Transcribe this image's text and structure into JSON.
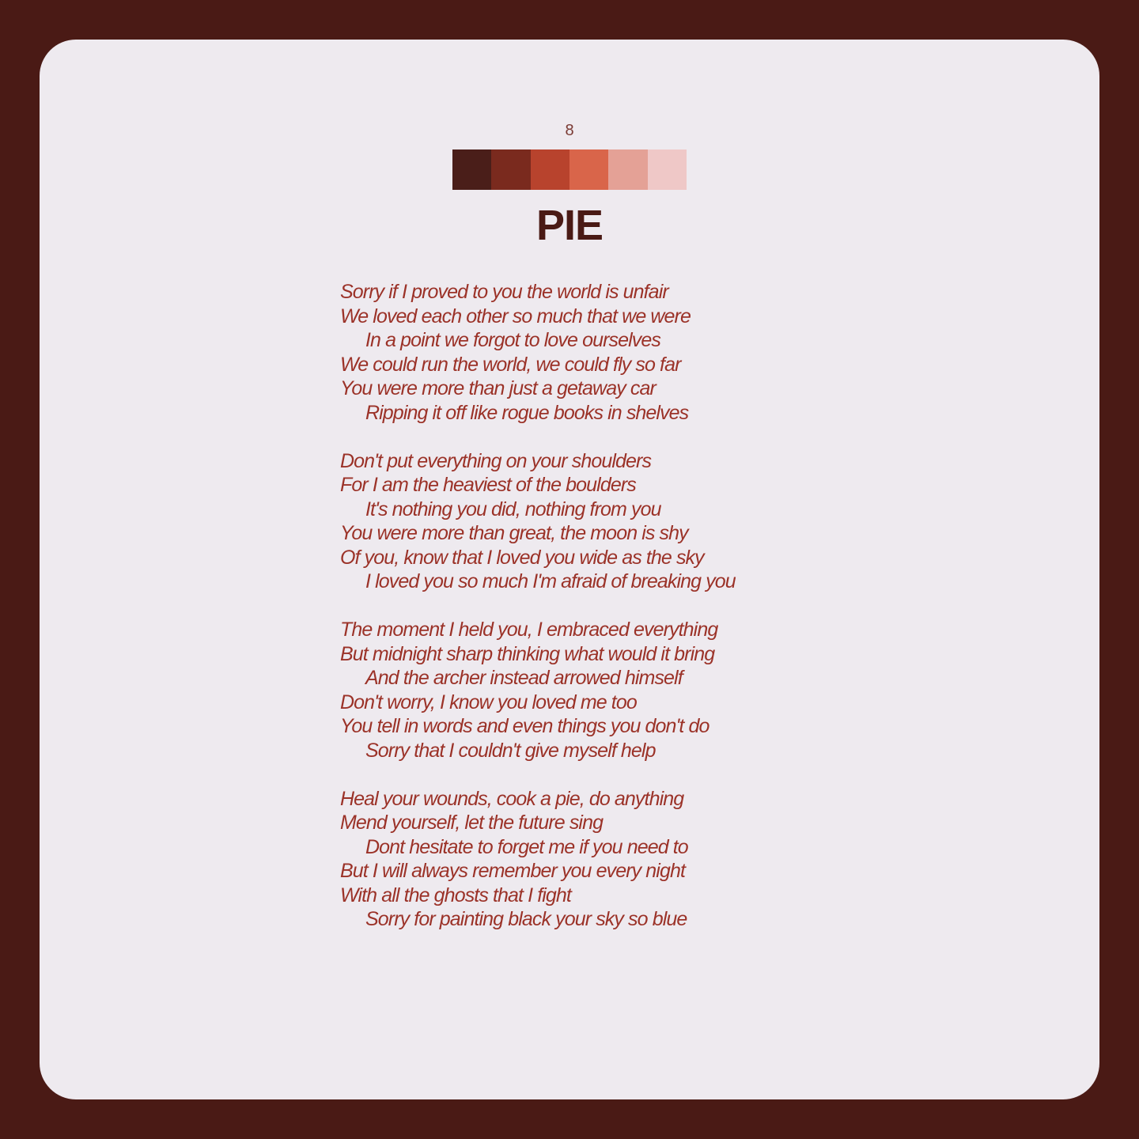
{
  "page": {
    "number": "8",
    "title": "PIE"
  },
  "palette": [
    "#4a1e19",
    "#7a2a1e",
    "#b8432d",
    "#d9654a",
    "#e4a196",
    "#efc8c7"
  ],
  "poem": {
    "stanzas": [
      {
        "lines": [
          {
            "text": "Sorry if I proved to you the world is unfair",
            "indent": false
          },
          {
            "text": "We loved each other so much that we were",
            "indent": false
          },
          {
            "text": "In a point we forgot to love ourselves",
            "indent": true
          },
          {
            "text": "We could run the world, we could fly so far",
            "indent": false
          },
          {
            "text": "You were more than just a getaway car",
            "indent": false
          },
          {
            "text": "Ripping it off like rogue books in shelves",
            "indent": true
          }
        ]
      },
      {
        "lines": [
          {
            "text": "Don't put everything on your shoulders",
            "indent": false
          },
          {
            "text": "For I am the heaviest of the boulders",
            "indent": false
          },
          {
            "text": "It's nothing you did, nothing from you",
            "indent": true
          },
          {
            "text": "You were more than great, the moon is shy",
            "indent": false
          },
          {
            "text": "Of you, know that I loved you wide as the sky",
            "indent": false
          },
          {
            "text": "I loved you so much I'm afraid of breaking you",
            "indent": true
          }
        ]
      },
      {
        "lines": [
          {
            "text": "The moment I held you, I embraced everything",
            "indent": false
          },
          {
            "text": "But midnight sharp thinking what would it bring",
            "indent": false
          },
          {
            "text": "And the archer instead arrowed himself",
            "indent": true
          },
          {
            "text": "Don't worry, I know you loved me too",
            "indent": false
          },
          {
            "text": "You tell in words and even things you don't do",
            "indent": false
          },
          {
            "text": "Sorry that I couldn't give myself help",
            "indent": true
          }
        ]
      },
      {
        "lines": [
          {
            "text": "Heal your wounds, cook a pie, do anything",
            "indent": false
          },
          {
            "text": "Mend yourself, let the future sing",
            "indent": false
          },
          {
            "text": "Dont hesitate to forget me if you need to",
            "indent": true
          },
          {
            "text": "But I will always remember you every night",
            "indent": false
          },
          {
            "text": "With all the ghosts that I fight",
            "indent": false
          },
          {
            "text": "Sorry for painting black your sky so blue",
            "indent": true
          }
        ]
      }
    ]
  }
}
